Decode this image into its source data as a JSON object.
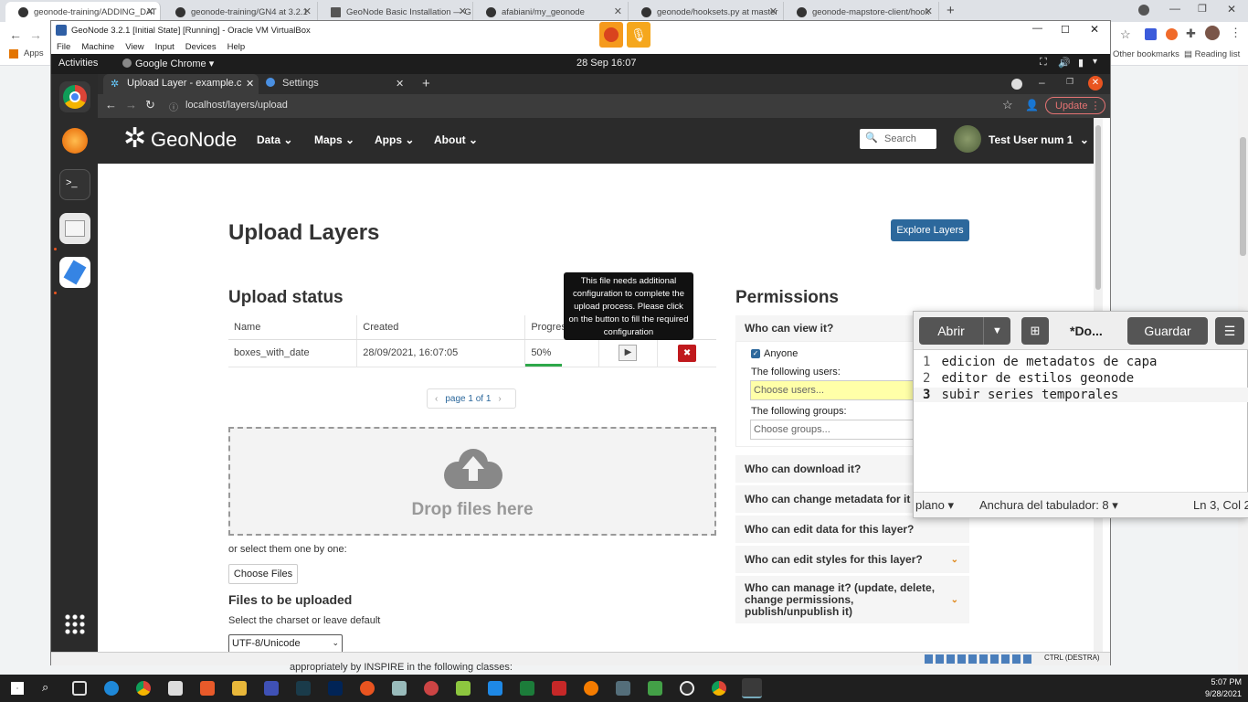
{
  "host_tabs": [
    {
      "label": "geonode-training/ADDING_DAT",
      "active": true
    },
    {
      "label": "geonode-training/GN4 at 3.2.1"
    },
    {
      "label": "GeoNode Basic Installation — G"
    },
    {
      "label": "afabiani/my_geonode"
    },
    {
      "label": "geonode/hooksets.py at master"
    },
    {
      "label": "geonode-mapstore-client/hook"
    }
  ],
  "host_bookmarks": {
    "apps": "Apps",
    "other": "Other bookmarks",
    "reading": "Reading list"
  },
  "vm": {
    "title": "GeoNode 3.2.1 [Initial State] [Running] - Oracle VM VirtualBox",
    "menu": [
      "File",
      "Machine",
      "View",
      "Input",
      "Devices",
      "Help"
    ],
    "status_key": "CTRL (DESTRA)"
  },
  "gnome": {
    "activities": "Activities",
    "app": "Google Chrome ▾",
    "clock": "28 Sep  16:07"
  },
  "guest_tabs": [
    {
      "label": "Upload Layer - example.c"
    },
    {
      "label": "Settings"
    }
  ],
  "guest_url": "localhost/layers/upload",
  "guest_update": "Update",
  "geonode": {
    "logo": "GeoNode",
    "menu": [
      "Data",
      "Maps",
      "Apps",
      "About"
    ],
    "search_placeholder": "Search",
    "user": "Test User num 1"
  },
  "upload": {
    "title": "Upload Layers",
    "explore_button": "Explore Layers",
    "status_title": "Upload status",
    "columns": [
      "Name",
      "Created",
      "Progress"
    ],
    "row": {
      "name": "boxes_with_date",
      "created": "28/09/2021, 16:07:05",
      "progress": "50%",
      "progress_value": 0.5
    },
    "tooltip": "This file needs additional configuration to complete the upload process. Please click on the button to fill the required configuration",
    "pager": "page 1 of 1",
    "drop_text": "Drop files here",
    "select_text": "or select them one by one:",
    "choose_button": "Choose Files",
    "files_title": "Files to be uploaded",
    "charset_label": "Select the charset or leave default",
    "charset_value": "UTF-8/Unicode",
    "inspire_text": "appropriately by INSPIRE in the following classes:"
  },
  "permissions": {
    "title": "Permissions",
    "view": "Who can view it?",
    "anyone": "Anyone",
    "users_label": "The following users:",
    "users_placeholder": "Choose users...",
    "groups_label": "The following groups:",
    "groups_placeholder": "Choose groups...",
    "download": "Who can download it?",
    "metadata": "Who can change metadata for it",
    "edit_data": "Who can edit data for this layer?",
    "edit_styles": "Who can edit styles for this layer?",
    "manage": "Who can manage it? (update, delete, change permissions, publish/unpublish it)"
  },
  "gedit": {
    "open": "Abrir",
    "title": "*Do...",
    "save": "Guardar",
    "lines": [
      "edicion de metadatos de capa",
      "editor de estilos geonode",
      "subir series temporales"
    ],
    "line_numbers": [
      "1",
      "2",
      "3"
    ],
    "mode": "plano",
    "tab_width": "Anchura del tabulador: 8",
    "position": "Ln 3, Col 2"
  },
  "taskbar": {
    "time": "5:07 PM",
    "date": "9/28/2021"
  }
}
